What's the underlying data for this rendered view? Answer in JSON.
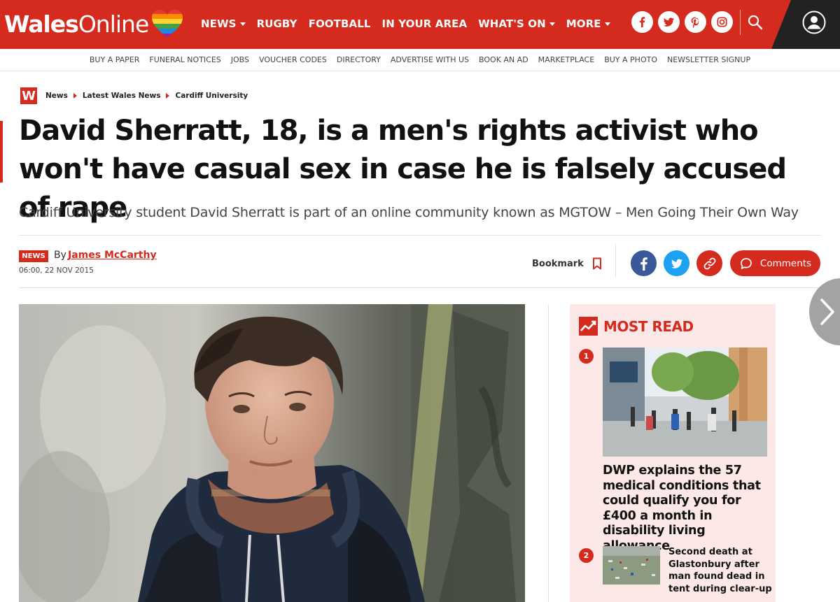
{
  "brand": {
    "logo_bold": "Wales",
    "logo_regular": "Online",
    "primary_color": "#d52b1e"
  },
  "main_nav": [
    {
      "label": "NEWS",
      "dropdown": true
    },
    {
      "label": "RUGBY",
      "dropdown": false
    },
    {
      "label": "FOOTBALL",
      "dropdown": false
    },
    {
      "label": "IN YOUR AREA",
      "dropdown": false
    },
    {
      "label": "WHAT'S ON",
      "dropdown": true
    },
    {
      "label": "MORE",
      "dropdown": true
    }
  ],
  "social_icons": [
    "facebook-icon",
    "twitter-icon",
    "pinterest-icon",
    "instagram-icon"
  ],
  "sub_nav": [
    "BUY A PAPER",
    "FUNERAL NOTICES",
    "JOBS",
    "VOUCHER CODES",
    "DIRECTORY",
    "ADVERTISE WITH US",
    "BOOK AN AD",
    "MARKETPLACE",
    "BUY A PHOTO",
    "NEWSLETTER SIGNUP"
  ],
  "breadcrumb": {
    "badge": "W",
    "items": [
      "News",
      "Latest Wales News",
      "Cardiff University"
    ]
  },
  "article": {
    "headline": "David Sherratt, 18, is a men's rights activist who won't have casual sex in case he is falsely accused of rape",
    "standfirst": "Cardiff University student David Sherratt is part of an online community known as MGTOW – Men Going Their Own Way",
    "tag": "NEWS",
    "by_label": "By",
    "author": "James McCarthy",
    "date": "06:00, 22 NOV 2015"
  },
  "actions": {
    "bookmark_label": "Bookmark",
    "comments_label": "Comments"
  },
  "most_read": {
    "title": "MOST READ",
    "items": [
      {
        "rank": "1",
        "headline": "DWP explains the 57 medical conditions that could qualify you for £400 a month in disability living allowance"
      },
      {
        "rank": "2",
        "headline": "Second death at Glastonbury after man found dead in tent during clear-up"
      }
    ]
  }
}
